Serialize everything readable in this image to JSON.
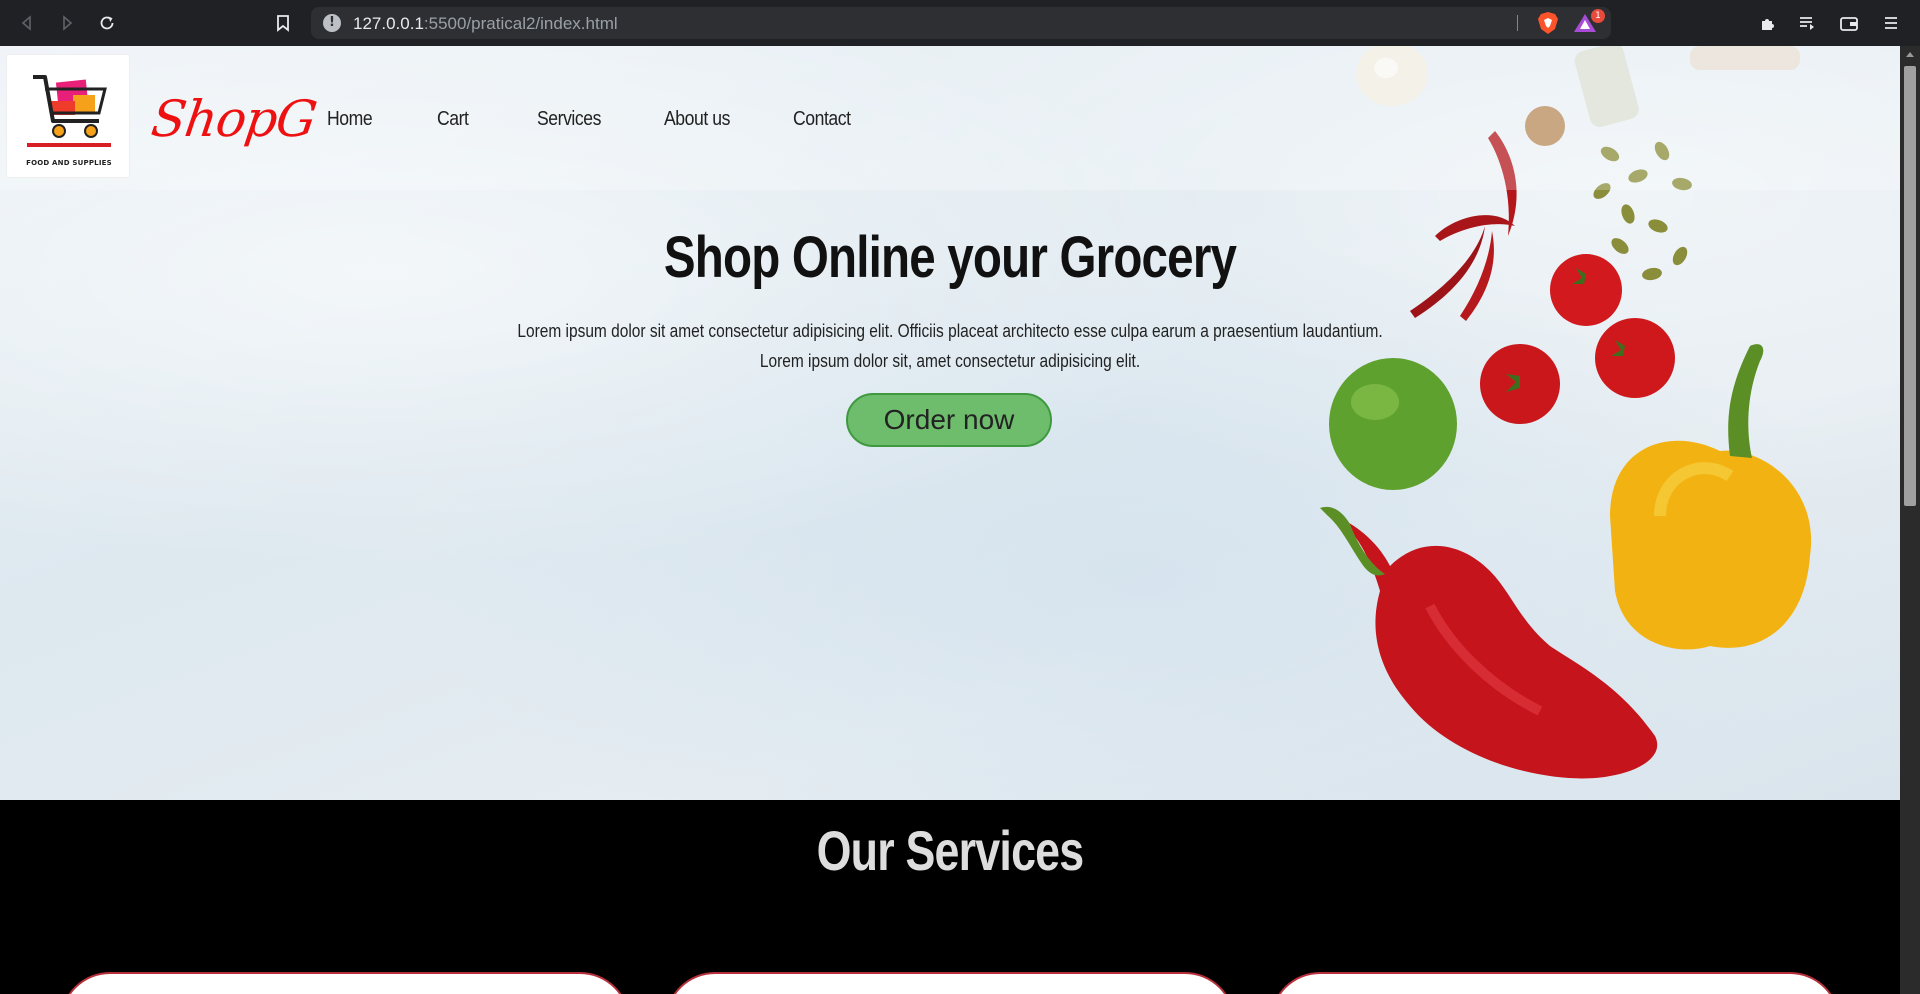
{
  "browser": {
    "url_host": "127.0.0.1",
    "url_rest": ":5500/pratical2/index.html",
    "rewards_badge": "1"
  },
  "site": {
    "logo_caption": "FOOD AND SUPPLIES",
    "brand": "ShopG",
    "nav": [
      "Home",
      "Cart",
      "Services",
      "About us",
      "Contact"
    ]
  },
  "hero": {
    "title": "Shop Online your Grocery",
    "text_line1": "Lorem ipsum dolor sit amet consectetur adipisicing elit. Officiis placeat architecto esse culpa earum a praesentium laudantium.",
    "text_line2": "Lorem ipsum dolor sit, amet consectetur adipisicing elit.",
    "cta": "Order now"
  },
  "services": {
    "title": "Our Services"
  },
  "colors": {
    "brand_red": "#ee1111",
    "cta_green": "#6dbd6d",
    "chrome_bg": "#202124"
  }
}
